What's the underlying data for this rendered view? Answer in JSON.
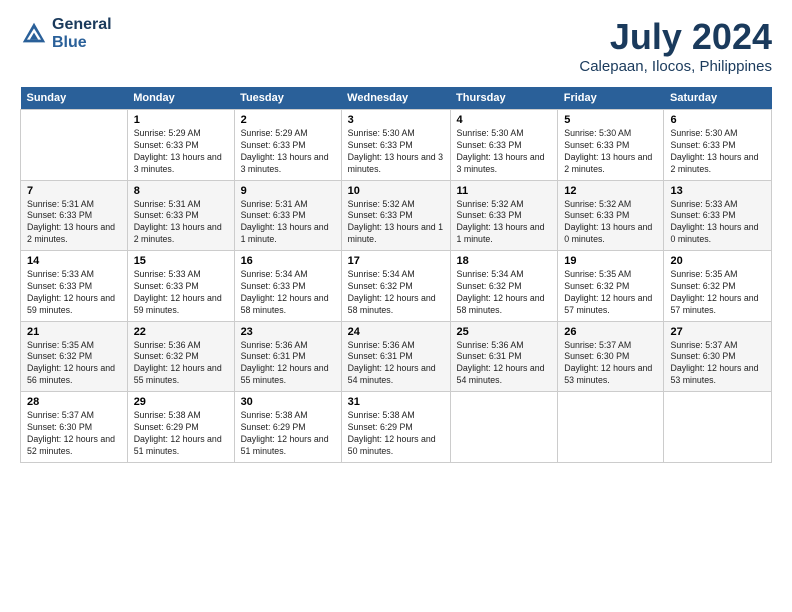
{
  "logo": {
    "line1": "General",
    "line2": "Blue"
  },
  "title": "July 2024",
  "subtitle": "Calepaan, Ilocos, Philippines",
  "days_header": [
    "Sunday",
    "Monday",
    "Tuesday",
    "Wednesday",
    "Thursday",
    "Friday",
    "Saturday"
  ],
  "weeks": [
    [
      {
        "num": "",
        "sunrise": "",
        "sunset": "",
        "daylight": ""
      },
      {
        "num": "1",
        "sunrise": "Sunrise: 5:29 AM",
        "sunset": "Sunset: 6:33 PM",
        "daylight": "Daylight: 13 hours and 3 minutes."
      },
      {
        "num": "2",
        "sunrise": "Sunrise: 5:29 AM",
        "sunset": "Sunset: 6:33 PM",
        "daylight": "Daylight: 13 hours and 3 minutes."
      },
      {
        "num": "3",
        "sunrise": "Sunrise: 5:30 AM",
        "sunset": "Sunset: 6:33 PM",
        "daylight": "Daylight: 13 hours and 3 minutes."
      },
      {
        "num": "4",
        "sunrise": "Sunrise: 5:30 AM",
        "sunset": "Sunset: 6:33 PM",
        "daylight": "Daylight: 13 hours and 3 minutes."
      },
      {
        "num": "5",
        "sunrise": "Sunrise: 5:30 AM",
        "sunset": "Sunset: 6:33 PM",
        "daylight": "Daylight: 13 hours and 2 minutes."
      },
      {
        "num": "6",
        "sunrise": "Sunrise: 5:30 AM",
        "sunset": "Sunset: 6:33 PM",
        "daylight": "Daylight: 13 hours and 2 minutes."
      }
    ],
    [
      {
        "num": "7",
        "sunrise": "Sunrise: 5:31 AM",
        "sunset": "Sunset: 6:33 PM",
        "daylight": "Daylight: 13 hours and 2 minutes."
      },
      {
        "num": "8",
        "sunrise": "Sunrise: 5:31 AM",
        "sunset": "Sunset: 6:33 PM",
        "daylight": "Daylight: 13 hours and 2 minutes."
      },
      {
        "num": "9",
        "sunrise": "Sunrise: 5:31 AM",
        "sunset": "Sunset: 6:33 PM",
        "daylight": "Daylight: 13 hours and 1 minute."
      },
      {
        "num": "10",
        "sunrise": "Sunrise: 5:32 AM",
        "sunset": "Sunset: 6:33 PM",
        "daylight": "Daylight: 13 hours and 1 minute."
      },
      {
        "num": "11",
        "sunrise": "Sunrise: 5:32 AM",
        "sunset": "Sunset: 6:33 PM",
        "daylight": "Daylight: 13 hours and 1 minute."
      },
      {
        "num": "12",
        "sunrise": "Sunrise: 5:32 AM",
        "sunset": "Sunset: 6:33 PM",
        "daylight": "Daylight: 13 hours and 0 minutes."
      },
      {
        "num": "13",
        "sunrise": "Sunrise: 5:33 AM",
        "sunset": "Sunset: 6:33 PM",
        "daylight": "Daylight: 13 hours and 0 minutes."
      }
    ],
    [
      {
        "num": "14",
        "sunrise": "Sunrise: 5:33 AM",
        "sunset": "Sunset: 6:33 PM",
        "daylight": "Daylight: 12 hours and 59 minutes."
      },
      {
        "num": "15",
        "sunrise": "Sunrise: 5:33 AM",
        "sunset": "Sunset: 6:33 PM",
        "daylight": "Daylight: 12 hours and 59 minutes."
      },
      {
        "num": "16",
        "sunrise": "Sunrise: 5:34 AM",
        "sunset": "Sunset: 6:33 PM",
        "daylight": "Daylight: 12 hours and 58 minutes."
      },
      {
        "num": "17",
        "sunrise": "Sunrise: 5:34 AM",
        "sunset": "Sunset: 6:32 PM",
        "daylight": "Daylight: 12 hours and 58 minutes."
      },
      {
        "num": "18",
        "sunrise": "Sunrise: 5:34 AM",
        "sunset": "Sunset: 6:32 PM",
        "daylight": "Daylight: 12 hours and 58 minutes."
      },
      {
        "num": "19",
        "sunrise": "Sunrise: 5:35 AM",
        "sunset": "Sunset: 6:32 PM",
        "daylight": "Daylight: 12 hours and 57 minutes."
      },
      {
        "num": "20",
        "sunrise": "Sunrise: 5:35 AM",
        "sunset": "Sunset: 6:32 PM",
        "daylight": "Daylight: 12 hours and 57 minutes."
      }
    ],
    [
      {
        "num": "21",
        "sunrise": "Sunrise: 5:35 AM",
        "sunset": "Sunset: 6:32 PM",
        "daylight": "Daylight: 12 hours and 56 minutes."
      },
      {
        "num": "22",
        "sunrise": "Sunrise: 5:36 AM",
        "sunset": "Sunset: 6:32 PM",
        "daylight": "Daylight: 12 hours and 55 minutes."
      },
      {
        "num": "23",
        "sunrise": "Sunrise: 5:36 AM",
        "sunset": "Sunset: 6:31 PM",
        "daylight": "Daylight: 12 hours and 55 minutes."
      },
      {
        "num": "24",
        "sunrise": "Sunrise: 5:36 AM",
        "sunset": "Sunset: 6:31 PM",
        "daylight": "Daylight: 12 hours and 54 minutes."
      },
      {
        "num": "25",
        "sunrise": "Sunrise: 5:36 AM",
        "sunset": "Sunset: 6:31 PM",
        "daylight": "Daylight: 12 hours and 54 minutes."
      },
      {
        "num": "26",
        "sunrise": "Sunrise: 5:37 AM",
        "sunset": "Sunset: 6:30 PM",
        "daylight": "Daylight: 12 hours and 53 minutes."
      },
      {
        "num": "27",
        "sunrise": "Sunrise: 5:37 AM",
        "sunset": "Sunset: 6:30 PM",
        "daylight": "Daylight: 12 hours and 53 minutes."
      }
    ],
    [
      {
        "num": "28",
        "sunrise": "Sunrise: 5:37 AM",
        "sunset": "Sunset: 6:30 PM",
        "daylight": "Daylight: 12 hours and 52 minutes."
      },
      {
        "num": "29",
        "sunrise": "Sunrise: 5:38 AM",
        "sunset": "Sunset: 6:29 PM",
        "daylight": "Daylight: 12 hours and 51 minutes."
      },
      {
        "num": "30",
        "sunrise": "Sunrise: 5:38 AM",
        "sunset": "Sunset: 6:29 PM",
        "daylight": "Daylight: 12 hours and 51 minutes."
      },
      {
        "num": "31",
        "sunrise": "Sunrise: 5:38 AM",
        "sunset": "Sunset: 6:29 PM",
        "daylight": "Daylight: 12 hours and 50 minutes."
      },
      {
        "num": "",
        "sunrise": "",
        "sunset": "",
        "daylight": ""
      },
      {
        "num": "",
        "sunrise": "",
        "sunset": "",
        "daylight": ""
      },
      {
        "num": "",
        "sunrise": "",
        "sunset": "",
        "daylight": ""
      }
    ]
  ]
}
